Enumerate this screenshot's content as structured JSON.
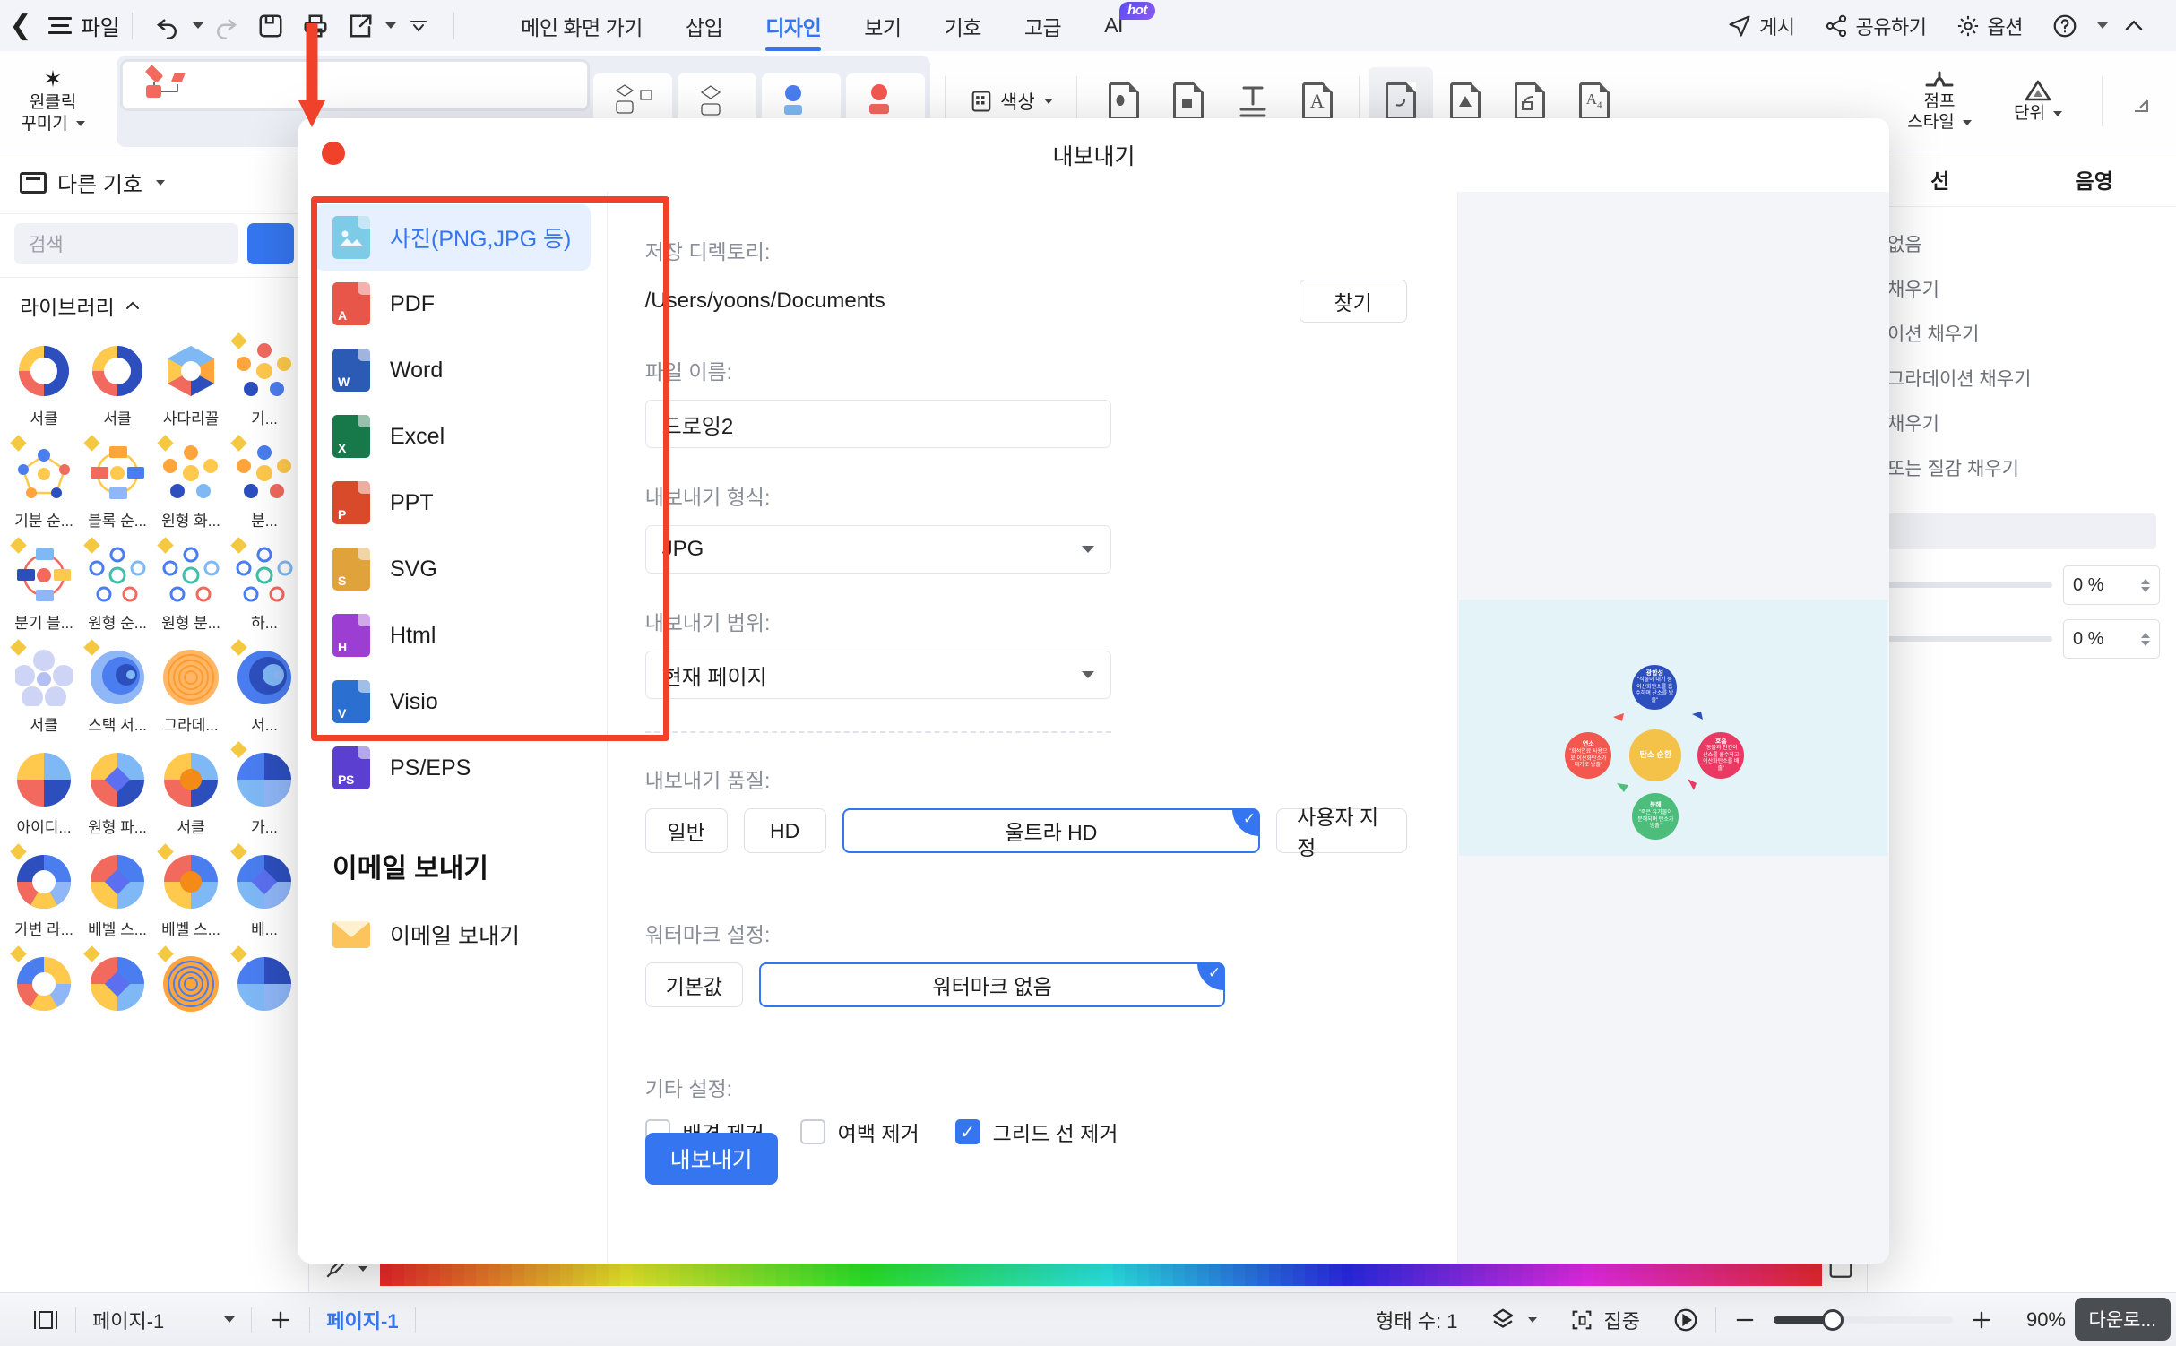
{
  "topbar": {
    "back_icon": "chevron-left-icon",
    "menu_icon": "hamburger-icon",
    "file_label": "파일",
    "undo_icon": "undo-icon",
    "redo_icon": "redo-icon",
    "save_icon": "save-icon",
    "print_icon": "print-icon",
    "export_icon": "export-icon",
    "more_icon": "chevron-down-icon",
    "tabs": [
      {
        "label": "메인 화면 가기",
        "active": false
      },
      {
        "label": "삽입",
        "active": false
      },
      {
        "label": "디자인",
        "active": true
      },
      {
        "label": "보기",
        "active": false
      },
      {
        "label": "기호",
        "active": false
      },
      {
        "label": "고급",
        "active": false
      },
      {
        "label": "AI",
        "active": false,
        "badge": "hot"
      }
    ],
    "right_items": [
      {
        "label": "게시",
        "icon": "send-icon"
      },
      {
        "label": "공유하기",
        "icon": "share-icon"
      },
      {
        "label": "옵션",
        "icon": "gear-icon"
      },
      {
        "label": "",
        "icon": "help-icon"
      },
      {
        "label": "",
        "icon": "collapse-ribbon-icon"
      }
    ]
  },
  "ribbon": {
    "oneclick_label": "원클릭\n꾸미기",
    "color_label": "색상",
    "jump_style_label": "점프\n스타일",
    "unit_label": "단위",
    "gallery_count": 5,
    "tool_icons": [
      "theme-fill-icon",
      "theme-shape-icon",
      "theme-text-icon",
      "theme-font-icon",
      "theme-connector-icon",
      "theme-shadow-icon",
      "theme-page-icon",
      "theme-fontsize-icon"
    ]
  },
  "left_panel": {
    "header_label": "다른 기호",
    "header_icon": "library-tray-icon",
    "search_placeholder": "검색",
    "search_button_icon": "search-icon",
    "section_label": "라이브러리",
    "section_collapse_icon": "chevron-up-icon",
    "shapes": [
      {
        "name": "서클",
        "c1": "#ffc94d",
        "c2": "#7eb8f5",
        "c3": "#f2695e",
        "c4": "#2d4fbe",
        "premium": false,
        "style": "ring-notched"
      },
      {
        "name": "서클",
        "c1": "#ffc94d",
        "c2": "#7eb8f5",
        "c3": "#f2695e",
        "c4": "#2d4fbe",
        "premium": false,
        "style": "ring"
      },
      {
        "name": "사다리꼴",
        "c1": "#ffc94d",
        "c2": "#7eb8f5",
        "c3": "#f2695e",
        "c4": "#2d4fbe",
        "premium": false,
        "style": "hex"
      },
      {
        "name": "기...",
        "c1": "#f2695e",
        "c2": "#ffc94d",
        "c3": "#4a7df0",
        "c4": "#2d4fbe",
        "premium": true,
        "style": "cluster"
      },
      {
        "name": "기분 순...",
        "c1": "#4a7df0",
        "c2": "#ffc94d",
        "c3": "#f2695e",
        "c4": "#2d4fbe",
        "premium": true,
        "style": "pentagon"
      },
      {
        "name": "블록 순...",
        "c1": "#ffa53c",
        "c2": "#ffc94d",
        "c3": "#f2695e",
        "c4": "#4a7df0",
        "premium": true,
        "style": "block"
      },
      {
        "name": "원형 화...",
        "c1": "#ffa53c",
        "c2": "#ffc94d",
        "c3": "#7eb8f5",
        "c4": "#2d4fbe",
        "premium": true,
        "style": "cluster"
      },
      {
        "name": "분...",
        "c1": "#4a7df0",
        "c2": "#ffc94d",
        "c3": "#f2695e",
        "c4": "#2d4fbe",
        "premium": true,
        "style": "cluster"
      },
      {
        "name": "분기 블...",
        "c1": "#7eb8f5",
        "c2": "#f2695e",
        "c3": "#2d4fbe",
        "c4": "#ffc94d",
        "premium": true,
        "style": "block"
      },
      {
        "name": "원형 순...",
        "c1": "#4a7df0",
        "c2": "#3fc0a8",
        "c3": "#f2695e",
        "c4": "#7eb8f5",
        "premium": true,
        "style": "outline-cluster"
      },
      {
        "name": "원형 분...",
        "c1": "#4a7df0",
        "c2": "#3fc0a8",
        "c3": "#f2695e",
        "c4": "#7eb8f5",
        "premium": true,
        "style": "outline-cluster"
      },
      {
        "name": "하...",
        "c1": "#4a7df0",
        "c2": "#3fc0a8",
        "c3": "#f2695e",
        "c4": "#7eb8f5",
        "premium": true,
        "style": "outline-cluster"
      },
      {
        "name": "서클",
        "c1": "#c5cdf5",
        "c2": "#c5cdf5",
        "c3": "#c5cdf5",
        "c4": "#c5cdf5",
        "premium": true,
        "style": "petal"
      },
      {
        "name": "스택 서...",
        "c1": "#8fb6f7",
        "c2": "#4a7df0",
        "c3": "#2d4fbe",
        "c4": "#7eb8f5",
        "premium": true,
        "style": "stack"
      },
      {
        "name": "그라데...",
        "c1": "#ffb766",
        "c2": "#ffa53c",
        "c3": "#ffc94d",
        "c4": "#ff9a2e",
        "premium": false,
        "style": "rings"
      },
      {
        "name": "서...",
        "c1": "#4a7df0",
        "c2": "#2d4fbe",
        "c3": "#7eb8f5",
        "c4": "#8fb6f7",
        "premium": true,
        "style": "stack"
      },
      {
        "name": "아이디...",
        "c1": "#ffc94d",
        "c2": "#7eb8f5",
        "c3": "#f2695e",
        "c4": "#2d4fbe",
        "premium": false,
        "style": "quad"
      },
      {
        "name": "원형 파...",
        "c1": "#ffc94d",
        "c2": "#7eb8f5",
        "c3": "#f2695e",
        "c4": "#2d4fbe",
        "premium": false,
        "style": "quad-core"
      },
      {
        "name": "서클",
        "c1": "#ffc94d",
        "c2": "#7eb8f5",
        "c3": "#f2695e",
        "c4": "#2d4fbe",
        "premium": false,
        "style": "quad-orange"
      },
      {
        "name": "가...",
        "c1": "#4a7df0",
        "c2": "#2d4fbe",
        "c3": "#7eb8f5",
        "c4": "#8fb6f7",
        "premium": true,
        "style": "quad"
      },
      {
        "name": "가변 라...",
        "c1": "#2d4fbe",
        "c2": "#4a7df0",
        "c3": "#f2695e",
        "c4": "#ffc94d",
        "premium": true,
        "style": "donut6"
      },
      {
        "name": "베벨 스...",
        "c1": "#f2695e",
        "c2": "#4a7df0",
        "c3": "#ffc94d",
        "c4": "#7eb8f5",
        "premium": false,
        "style": "quad-core"
      },
      {
        "name": "베벨 스...",
        "c1": "#f2695e",
        "c2": "#4a7df0",
        "c3": "#ffc94d",
        "c4": "#7eb8f5",
        "premium": true,
        "style": "quad-orange"
      },
      {
        "name": "베...",
        "c1": "#4a7df0",
        "c2": "#2d4fbe",
        "c3": "#7eb8f5",
        "c4": "#8fb6f7",
        "premium": true,
        "style": "quad-core"
      },
      {
        "name": "",
        "c1": "#4a7df0",
        "c2": "#ffc94d",
        "c3": "#f2695e",
        "c4": "#7eb8f5",
        "premium": true,
        "style": "donut6"
      },
      {
        "name": "",
        "c1": "#f2695e",
        "c2": "#4a7df0",
        "c3": "#ffc94d",
        "c4": "#7eb8f5",
        "premium": true,
        "style": "quad-core"
      },
      {
        "name": "",
        "c1": "#ffa53c",
        "c2": "#ffc94d",
        "c3": "#f2695e",
        "c4": "#4a7df0",
        "premium": true,
        "style": "rings"
      },
      {
        "name": "",
        "c1": "#4a7df0",
        "c2": "#2d4fbe",
        "c3": "#7eb8f5",
        "c4": "#8fb6f7",
        "premium": true,
        "style": "quad"
      }
    ]
  },
  "right_panel": {
    "tabs": [
      "선",
      "음영"
    ],
    "rows": [
      "없음",
      "채우기",
      "이션 채우기",
      "그라데이션 채우기",
      "채우기",
      "또는 질감 채우기"
    ],
    "value_1": "0 %",
    "value_2": "0 %"
  },
  "dialog": {
    "title": "내보내기",
    "close_icon": "close-icon",
    "sidebar": {
      "items": [
        {
          "label": "사진(PNG,JPG 등)",
          "tag": "",
          "color": "#7ecbe8",
          "active": true
        },
        {
          "label": "PDF",
          "tag": "A",
          "color": "#e8564a",
          "active": false
        },
        {
          "label": "Word",
          "tag": "W",
          "color": "#2b5bb5",
          "active": false
        },
        {
          "label": "Excel",
          "tag": "X",
          "color": "#17794a",
          "active": false
        },
        {
          "label": "PPT",
          "tag": "P",
          "color": "#d94a2b",
          "active": false
        },
        {
          "label": "SVG",
          "tag": "S",
          "color": "#e0a23a",
          "active": false
        },
        {
          "label": "Html",
          "tag": "H",
          "color": "#9b3ed1",
          "active": false
        },
        {
          "label": "Visio",
          "tag": "V",
          "color": "#2b6fd1",
          "active": false
        },
        {
          "label": "PS/EPS",
          "tag": "PS",
          "color": "#5b3fd1",
          "active": false
        }
      ],
      "email_heading": "이메일 보내기",
      "email_item": "이메일 보내기",
      "email_icon": "envelope-icon"
    },
    "form": {
      "dir_label": "저장 디렉토리:",
      "dir_value": "/Users/yoons/Documents",
      "browse_button": "찾기",
      "filename_label": "파일 이름:",
      "filename_value": "드로잉2",
      "format_label": "내보내기 형식:",
      "format_value": "JPG",
      "range_label": "내보내기 범위:",
      "range_value": "현재 페이지",
      "quality_label": "내보내기 품질:",
      "quality_options": [
        {
          "label": "일반",
          "selected": false
        },
        {
          "label": "HD",
          "selected": false
        },
        {
          "label": "울트라 HD",
          "selected": true
        },
        {
          "label": "사용자 지정",
          "selected": false
        }
      ],
      "watermark_label": "워터마크 설정:",
      "watermark_options": [
        {
          "label": "기본값",
          "selected": false
        },
        {
          "label": "워터마크 없음",
          "selected": true
        }
      ],
      "other_label": "기타 설정:",
      "other_options": [
        {
          "label": "배경 제거",
          "checked": false
        },
        {
          "label": "여백 제거",
          "checked": false
        },
        {
          "label": "그리드 선 제거",
          "checked": true
        }
      ],
      "export_button": "내보내기"
    },
    "preview": {
      "center": {
        "title": "탄소 순환",
        "color": "#f5c249"
      },
      "nodes": [
        {
          "title": "광합성",
          "desc": "\"식물이 대기 중 이산화탄소를 흡수하며 산소를 방출\"",
          "color": "#2d4fbe",
          "pos": "top"
        },
        {
          "title": "호흡",
          "desc": "\"동물과 인간이 산소를 흡수하고 이산화탄소를 배출\"",
          "color": "#ea3a63",
          "pos": "right"
        },
        {
          "title": "분해",
          "desc": "\"죽은 유기물이 분해되며 탄소가 방출\"",
          "color": "#4cbd7a",
          "pos": "bottom"
        },
        {
          "title": "연소",
          "desc": "\"화석연료 사용으로 이산화탄소가 대기로 방출\"",
          "color": "#f2584f",
          "pos": "left"
        }
      ]
    }
  },
  "statusbar": {
    "layout_icon": "page-layout-icon",
    "page_select": "페이지-1",
    "add_icon": "plus-icon",
    "page_tab": "페이지-1",
    "shape_count": "형태 수: 1",
    "layers_icon": "layers-icon",
    "focus_label": "집중",
    "play_icon": "play-icon",
    "zoom_out_icon": "minus-icon",
    "zoom_in_icon": "plus-icon",
    "zoom_level": "90%",
    "fit_icon": "fit-page-icon",
    "tooltip": "다운로..."
  }
}
